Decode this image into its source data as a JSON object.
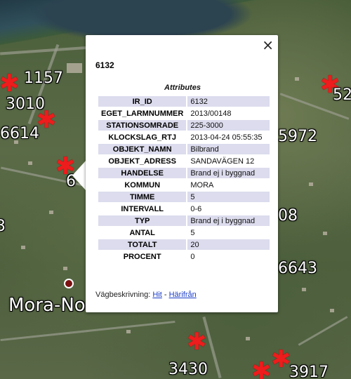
{
  "map": {
    "markers": [
      {
        "label": "1157"
      },
      {
        "label": "3010"
      },
      {
        "label": "6614"
      },
      {
        "label": "6"
      },
      {
        "label": "3"
      },
      {
        "label": "52"
      },
      {
        "label": "5972"
      },
      {
        "label": "08"
      },
      {
        "label": "6643"
      },
      {
        "label": "3430"
      },
      {
        "label": "3917"
      }
    ],
    "place_name": "Mora-No"
  },
  "popup": {
    "title": "6132",
    "caption": "Attributes",
    "close_icon": "×",
    "rows": [
      {
        "key": "IR_ID",
        "value": "6132"
      },
      {
        "key": "EGET_LARMNUMMER",
        "value": "2013/00148"
      },
      {
        "key": "STATIONSOMRADE",
        "value": "225-3000"
      },
      {
        "key": "KLOCKSLAG_RTJ",
        "value": "2013-04-24 05:55:35"
      },
      {
        "key": "OBJEKT_NAMN",
        "value": "Bilbrand"
      },
      {
        "key": "OBJEKT_ADRESS",
        "value": "SANDAVÄGEN 12"
      },
      {
        "key": "HANDELSE",
        "value": "Brand ej i byggnad"
      },
      {
        "key": "KOMMUN",
        "value": "MORA"
      },
      {
        "key": "TIMME",
        "value": "5"
      },
      {
        "key": "INTERVALL",
        "value": "0-6"
      },
      {
        "key": "TYP",
        "value": "Brand ej i byggnad"
      },
      {
        "key": "ANTAL",
        "value": "5"
      },
      {
        "key": "TOTALT",
        "value": "20"
      },
      {
        "key": "PROCENT",
        "value": "0"
      }
    ],
    "directions": {
      "label": "Vägbeskrivning:",
      "to_link": "Hit",
      "separator": "-",
      "from_link": "Härifrån"
    }
  }
}
